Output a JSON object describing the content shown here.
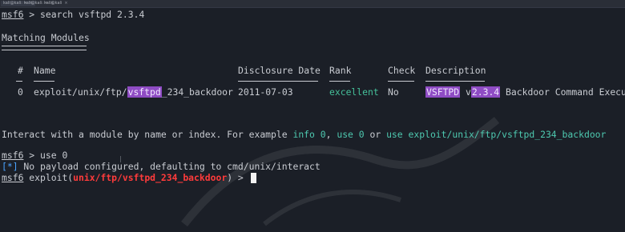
{
  "tabs": [
    {
      "label": "kali@kali: ~",
      "close": "×"
    },
    {
      "label": "kali@kali: ~",
      "close": "×"
    },
    {
      "label": "kali@kali",
      "close": "×"
    }
  ],
  "terminal": {
    "prompt1": {
      "prompt": "msf6",
      "arrow": " > ",
      "command": "search vsftpd 2.3.4"
    },
    "matching_title": "Matching Modules",
    "table": {
      "headers": {
        "num": "#",
        "name": "Name",
        "date": "Disclosure Date",
        "rank": "Rank",
        "check": "Check",
        "desc": "Description"
      },
      "row": {
        "num": "0",
        "name_prefix": "exploit/unix/ftp/",
        "name_hl": "vsftpd",
        "name_suffix": "_234_backdoor",
        "date": "2011-07-03",
        "rank": "excellent",
        "check": "No",
        "desc_hl1": "VSFTPD",
        "desc_mid": " v",
        "desc_hl2": "2.3.4",
        "desc_rest": " Backdoor Command Execu"
      }
    },
    "interact": {
      "text1": "Interact with a module by name or index. For example ",
      "ex1": "info 0",
      "comma": ", ",
      "ex2": "use 0",
      "or": " or ",
      "ex3": "use exploit/unix/ftp/vsftpd_234_backdoor"
    },
    "prompt2": {
      "prompt": "msf6",
      "arrow": " > ",
      "command": "use 0"
    },
    "info": {
      "bracket_open": "[",
      "star": "*",
      "bracket_close": "]",
      "text": " No payload configured, defaulting to cmd/unix/interact"
    },
    "prompt3": {
      "prompt": "msf6",
      "pre": " exploit(",
      "module": "unix/ftp/vsftpd_234_backdoor",
      "post": ") > "
    }
  },
  "colors": {
    "background": "#1b1f27",
    "highlight": "#8f4cc4",
    "module_red": "#ff3b3b",
    "rank_green": "#45c09a"
  }
}
